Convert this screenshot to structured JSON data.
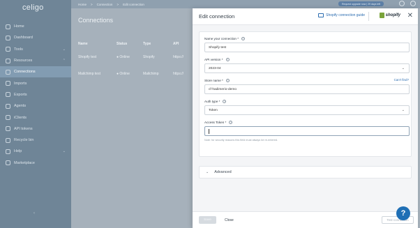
{
  "app": {
    "logo": "celigo"
  },
  "topbar": {
    "breadcrumbs": [
      "Home",
      ">",
      "Connection",
      ">",
      "Edit connection"
    ],
    "upgrade_label": "Request upgrade now | 29 days left"
  },
  "sidebar": {
    "items": [
      {
        "label": "Home",
        "icon": "home-icon"
      },
      {
        "label": "Dashboard",
        "icon": "dashboard-icon"
      },
      {
        "label": "Tools",
        "icon": "tools-icon",
        "chevron": "⌄"
      },
      {
        "label": "Resources",
        "icon": "resources-icon",
        "chevron": "⌃"
      },
      {
        "label": "Connections",
        "icon": "connections-icon",
        "active": true
      },
      {
        "label": "Imports",
        "icon": "imports-icon"
      },
      {
        "label": "Exports",
        "icon": "exports-icon"
      },
      {
        "label": "Agents",
        "icon": "agents-icon"
      },
      {
        "label": "iClients",
        "icon": "iclients-icon"
      },
      {
        "label": "API tokens",
        "icon": "api-tokens-icon"
      },
      {
        "label": "Recycle bin",
        "icon": "recycle-bin-icon"
      },
      {
        "label": "Help",
        "icon": "help-icon",
        "chevron": "⌄"
      },
      {
        "label": "Marketplace",
        "icon": "marketplace-icon"
      }
    ],
    "collapse_label": "‹"
  },
  "page": {
    "title": "Connections",
    "table": {
      "headers": [
        "Name",
        "Status",
        "Type",
        "API"
      ],
      "rows": [
        [
          "Shopify test",
          "● Online",
          "Shopify",
          "https://"
        ],
        [
          "Mailchimp test",
          "● Online",
          "Mailchimp",
          "https://"
        ]
      ]
    }
  },
  "drawer": {
    "title": "Edit connection",
    "guide_label": "Shopify connection guide",
    "brand_label": "shopify",
    "close_label": "✕",
    "fields": {
      "name_label": "Name your connection *",
      "name_value": "Shopify test",
      "api_label": "API version *",
      "api_value": "2023-04",
      "store_label": "Store name *",
      "store_value": "cf-hadimerio-demo",
      "cant_find": "Can't find?",
      "auth_label": "Auth type *",
      "auth_value": "Token",
      "token_label": "Access Token *",
      "token_value": "",
      "token_note": "Note: for security reasons this field must always be re-entered."
    },
    "advanced_label": "Advanced",
    "footer": {
      "save_label": "Save",
      "close_label": "Close",
      "test_label": "Test connection"
    },
    "help_label": "?"
  }
}
